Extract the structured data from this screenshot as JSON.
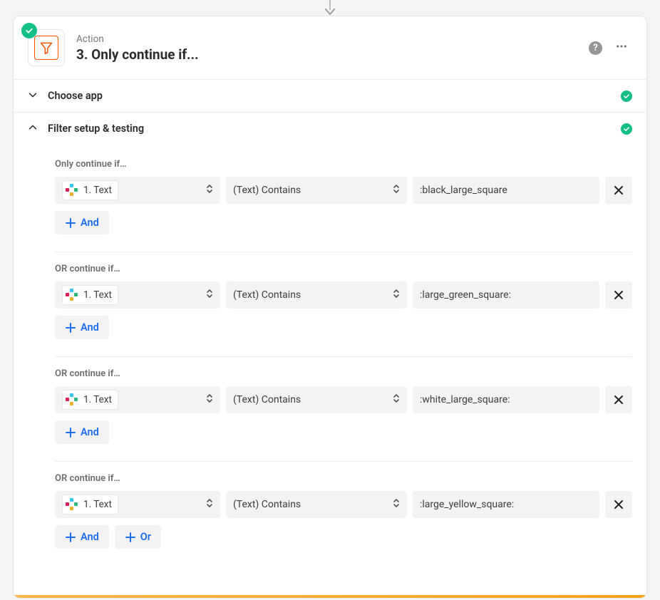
{
  "header": {
    "subtitle": "Action",
    "title": "3. Only continue if..."
  },
  "sections": {
    "choose_app": "Choose app",
    "filter_setup": "Filter setup & testing"
  },
  "labels": {
    "only_continue_if": "Only continue if…",
    "or_continue_if": "OR continue if…",
    "and": "And",
    "or": "Or"
  },
  "field": {
    "text": "1. Text"
  },
  "operator": "(Text) Contains",
  "conditions": [
    {
      "value": ":black_large_square"
    },
    {
      "value": ":large_green_square:"
    },
    {
      "value": ":white_large_square:"
    },
    {
      "value": ":large_yellow_square:"
    }
  ]
}
